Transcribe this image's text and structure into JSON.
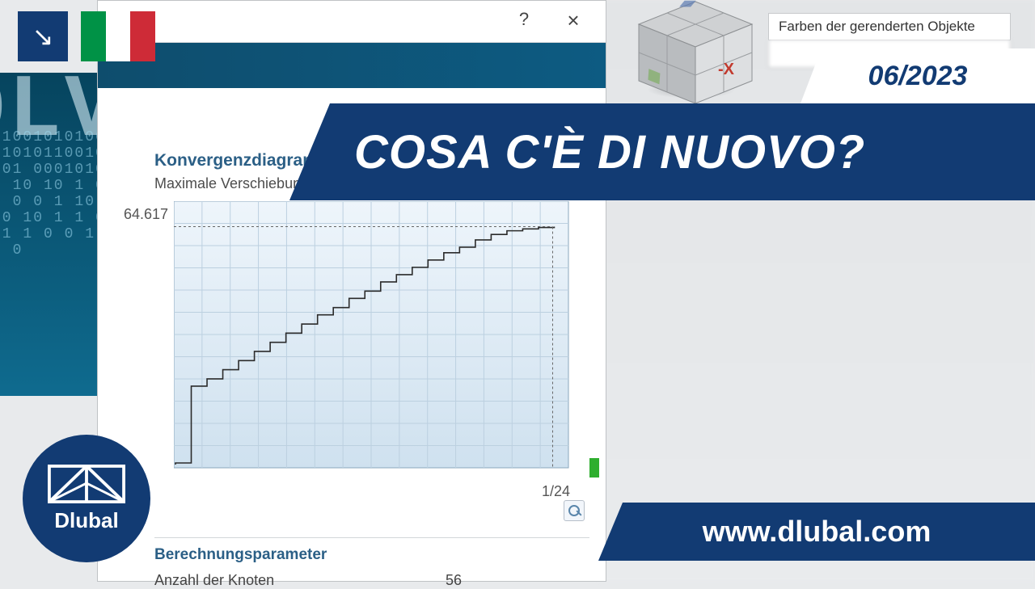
{
  "overlay": {
    "date": "06/2023",
    "title": "COSA C'È DI NUOVO?",
    "url": "www.dlubal.com",
    "logo_text": "Dlubal",
    "corner_arrow": "↘"
  },
  "side_panel": {
    "row1": "Farben der gerenderten Objekte",
    "row2": ""
  },
  "cube": {
    "neg_x": "-X"
  },
  "solver_bg_text": "OLVER",
  "dialog": {
    "help": "?",
    "close": "×",
    "konvergenz_title": "Konvergenzdiagramm",
    "konvergenz_sub": "Maximale Verschiebung [mm]",
    "params_title": "Berechnungsparameter",
    "param1_k": "Anzahl der Knoten",
    "param1_v": "56"
  },
  "chart_data": {
    "type": "line",
    "title": "Konvergenzdiagramm",
    "ylabel": "Maximale Verschiebung [mm]",
    "xlabel_visible": "1/24",
    "ylim": [
      0,
      70
    ],
    "y_tick_value": 64.617,
    "x": [
      0,
      1,
      2,
      3,
      4,
      5,
      6,
      7,
      8,
      9,
      10,
      11,
      12,
      13,
      14,
      15,
      16,
      17,
      18,
      19,
      20,
      21,
      22,
      23,
      24
    ],
    "values": [
      0,
      21,
      23,
      25.5,
      28,
      30.5,
      33,
      35.5,
      38,
      40.5,
      42.5,
      45,
      47,
      49.5,
      51.5,
      53.5,
      55.5,
      57.5,
      59,
      61,
      62.5,
      63.5,
      64,
      64.4,
      64.617
    ]
  }
}
